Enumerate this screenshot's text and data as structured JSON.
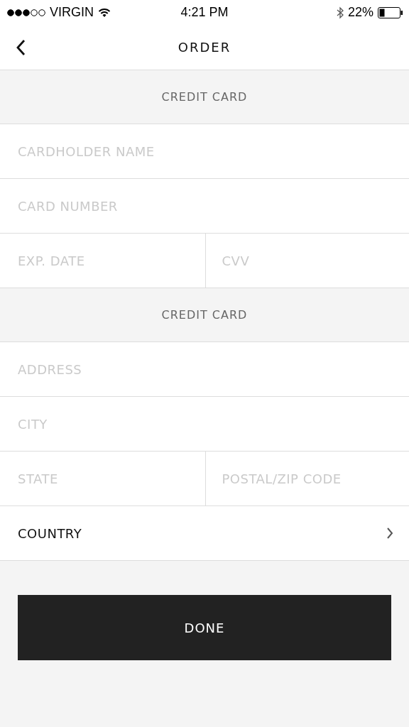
{
  "status_bar": {
    "carrier": "VIRGIN",
    "time": "4:21 PM",
    "battery": "22%"
  },
  "nav": {
    "title": "ORDER"
  },
  "sections": [
    {
      "kind": "header",
      "label": "CREDIT CARD"
    },
    {
      "kind": "fields",
      "fields": [
        {
          "placeholder": "CARDHOLDER NAME"
        }
      ]
    },
    {
      "kind": "fields",
      "fields": [
        {
          "placeholder": "CARD NUMBER"
        }
      ]
    },
    {
      "kind": "fields",
      "fields": [
        {
          "placeholder": "EXP. DATE"
        },
        {
          "placeholder": "CVV"
        }
      ]
    },
    {
      "kind": "header",
      "label": "CREDIT CARD"
    },
    {
      "kind": "fields",
      "fields": [
        {
          "placeholder": "ADDRESS"
        }
      ]
    },
    {
      "kind": "fields",
      "fields": [
        {
          "placeholder": "CITY"
        }
      ]
    },
    {
      "kind": "fields",
      "fields": [
        {
          "placeholder": "STATE"
        },
        {
          "placeholder": "POSTAL/ZIP CODE"
        }
      ]
    },
    {
      "kind": "select",
      "label": "COUNTRY"
    }
  ],
  "done_button": "DONE"
}
